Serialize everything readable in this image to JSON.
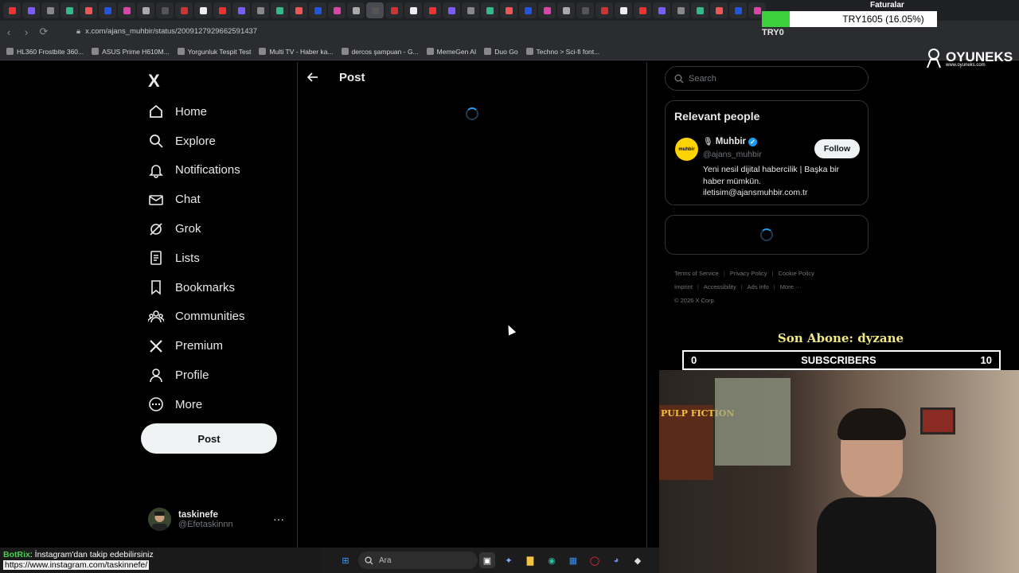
{
  "browser": {
    "url": "x.com/ajans_muhbir/status/2009127929662591437",
    "faturalar": "Faturalar",
    "try_overlay": "TRY1605 (16.05%)",
    "try_label": "TRY0",
    "try_progress_percent": 16.05,
    "bookmarks": [
      "HL360 Frostbite 360...",
      "ASUS Prime H610M...",
      "Yorgunluk Tespit Test",
      "Multi TV - Haber ka...",
      "dercos şampuan - G...",
      "MemeGen AI",
      "Duo Go",
      "Techno > Sci-fi font..."
    ]
  },
  "sidebar": {
    "logo": "X",
    "items": [
      {
        "label": "Home",
        "icon": "home-icon"
      },
      {
        "label": "Explore",
        "icon": "search-icon"
      },
      {
        "label": "Notifications",
        "icon": "bell-icon"
      },
      {
        "label": "Chat",
        "icon": "mail-icon"
      },
      {
        "label": "Grok",
        "icon": "grok-icon"
      },
      {
        "label": "Lists",
        "icon": "list-icon"
      },
      {
        "label": "Bookmarks",
        "icon": "bookmark-icon"
      },
      {
        "label": "Communities",
        "icon": "communities-icon"
      },
      {
        "label": "Premium",
        "icon": "x-icon"
      },
      {
        "label": "Profile",
        "icon": "person-icon"
      },
      {
        "label": "More",
        "icon": "more-circle-icon"
      }
    ],
    "post_label": "Post",
    "user": {
      "name": "taskinefe",
      "handle": "@Efetaskinnn"
    }
  },
  "main": {
    "title": "Post"
  },
  "right": {
    "search_placeholder": "Search",
    "relevant_title": "Relevant people",
    "person": {
      "name": "Muhbir",
      "handle": "@ajans_muhbir",
      "bio": "Yeni nesil dijital habercilik | Başka bir haber mümkün. iletisim@ajansmuhbir.com.tr",
      "follow_label": "Follow",
      "avatar_text": "muhbir"
    },
    "footer": [
      "Terms of Service",
      "Privacy Policy",
      "Cookie Policy",
      "Imprint",
      "Accessibility",
      "Ads info",
      "More ···",
      "© 2026 X Corp."
    ]
  },
  "stream": {
    "son_abone": "Son Abone: dyzane",
    "sub_left": "0",
    "sub_label": "SUBSCRIBERS",
    "sub_right": "10",
    "brand": "OYUNEKS",
    "brand_url": "www.oyuneks.com",
    "poster_text": "PULP FICTION"
  },
  "taskbar": {
    "botrix_user": "BotRix",
    "botrix_msg": ": İnstagram'dan takip edebilirsiniz",
    "botrix_link": "https://www.instagram.com/taskinnefe/",
    "search_placeholder": "Ara"
  }
}
